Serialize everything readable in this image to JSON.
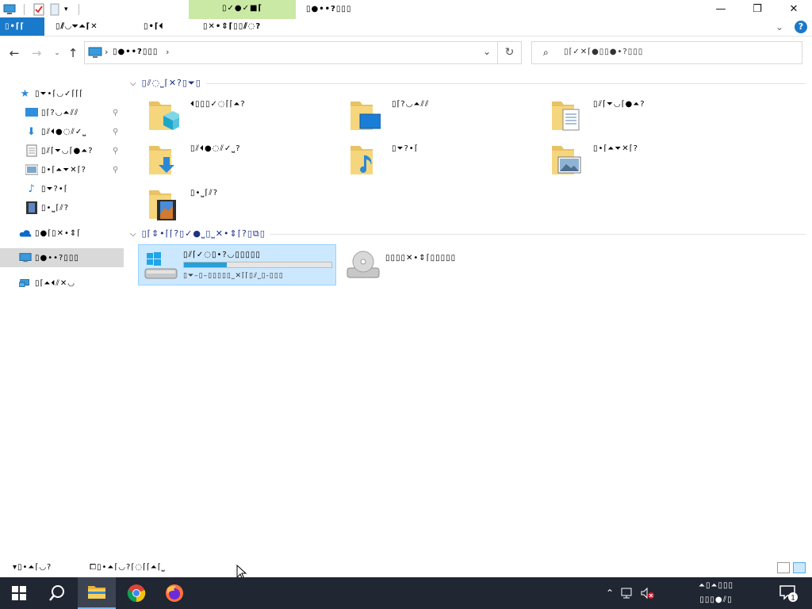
{
  "window": {
    "title": "▯●••?▯▯▯",
    "contextual_tab_group": "▯✓●✓■⌈",
    "caption": {
      "minimize": "—",
      "maximize": "❐",
      "close": "✕"
    }
  },
  "ribbon": {
    "tabs": [
      {
        "label": "▯•⌈⌈",
        "active": true
      },
      {
        "label": "▯⫽◡⏷⏶⌈✕"
      },
      {
        "label": "▯•⌈⏴"
      },
      {
        "label": "▯✕•⇕⌈▯▯⫽◌?"
      }
    ],
    "collapse_glyph": "⌄",
    "help_glyph": "?"
  },
  "nav": {
    "back": "←",
    "forward": "→",
    "recent": "⌄",
    "up": "↑",
    "address_crumb": "▯●••?▯▯▯",
    "address_sep": "›",
    "address_dropdown": "⌄",
    "refresh": "↻",
    "search_placeholder": "▯⌈✓✕⌈●▯▯●•?▯▯▯"
  },
  "navpane": {
    "items": [
      {
        "label": "▯⏷•⌈◡✓⌈⌈⌈",
        "icon": "star-icon",
        "pinned": false
      },
      {
        "label": "▯⌈?◡⏶⫽⫽",
        "icon": "desktop-icon",
        "pinned": true
      },
      {
        "label": "▯⫽⏴●◌⫽✓⎵",
        "icon": "downloads-icon",
        "pinned": true
      },
      {
        "label": "▯⫽⌈⏷◡⌈●⏶?",
        "icon": "documents-icon",
        "pinned": true
      },
      {
        "label": "▯•⌈⏶⏷✕⌈?",
        "icon": "pictures-icon",
        "pinned": true
      },
      {
        "label": "▯⏷?•⌈",
        "icon": "music-icon",
        "pinned": false
      },
      {
        "label": "▯•⎵⌈⫽?",
        "icon": "videos-icon",
        "pinned": false
      },
      {
        "label": "▯●⌈▯✕•⇕⌈",
        "icon": "onedrive-icon",
        "pinned": false
      },
      {
        "label": "▯●••?▯▯▯",
        "icon": "this-pc-icon",
        "pinned": false,
        "selected": true
      },
      {
        "label": "▯⌈⏶⏴⫽✕◡",
        "icon": "network-icon",
        "pinned": false
      }
    ],
    "pin_glyph": "📌"
  },
  "content": {
    "folders_header": "▯⫽◌⎵⌈✕?▯⏷▯",
    "folders": [
      {
        "name": "⏴▯▯▯✓◌⌈⌈⏶?",
        "overlay": "3d-objects-icon"
      },
      {
        "name": "▯⌈?◡⏶⫽⫽",
        "overlay": "desktop-icon"
      },
      {
        "name": "▯⫽⌈⏷◡⌈●⏶?",
        "overlay": "documents-icon"
      },
      {
        "name": "▯⫽⏴●◌⫽✓⎵?",
        "overlay": "downloads-icon"
      },
      {
        "name": "▯⏷?•⌈",
        "overlay": "music-icon"
      },
      {
        "name": "▯•⌈⏶⏷✕⌈?",
        "overlay": "pictures-icon"
      },
      {
        "name": "▯•⎵⌈⫽?",
        "overlay": "videos-icon"
      }
    ],
    "drives_header": "▯⌈⇕•⌈⌈?▯✓●⎵▯⎵✕•⇕⌈?▯⧉▯",
    "drives": [
      {
        "name": "▯⫽⌈✓◌▯•?◡▯▯▯▯▯",
        "free_text": "▯⏷–▯–▯▯▯▯▯⎵✕⌈⌈▯⫽⎵▯-▯▯▯",
        "used_fraction": 0.29,
        "selected": true,
        "icon": "windows-drive-icon"
      },
      {
        "name": "▯▯▯▯✕•⇕⌈▯▯▯▯▯",
        "free_text": "",
        "used_fraction": null,
        "selected": false,
        "icon": "dvd-drive-icon"
      }
    ]
  },
  "statusbar": {
    "item_count": "▾▯•⏶⌈◡?",
    "selection": "⧠▯•⏶⌈◡?⌈◌⌈⌈⏶⌈⎵"
  },
  "taskbar": {
    "buttons": [
      {
        "name": "start-button",
        "icon": "windows-logo-icon"
      },
      {
        "name": "search-button",
        "icon": "search-icon"
      },
      {
        "name": "file-explorer-button",
        "icon": "folder-icon",
        "active": true
      },
      {
        "name": "chrome-button",
        "icon": "chrome-icon"
      },
      {
        "name": "firefox-button",
        "icon": "firefox-icon"
      }
    ],
    "clock_time": "⏶▯⏶▯▯▯",
    "clock_date": "▯▯▯●⫽▯",
    "clock_date2": "▯◦•⏷▯▯⌈▯▯▯",
    "notification_count": "1"
  },
  "colors": {
    "accent": "#1979ca",
    "context_tab": "#c9e9a5",
    "selection": "#cce8ff",
    "group_header": "#1e3287",
    "taskbar": "#202632",
    "progress": "#26a0da"
  }
}
